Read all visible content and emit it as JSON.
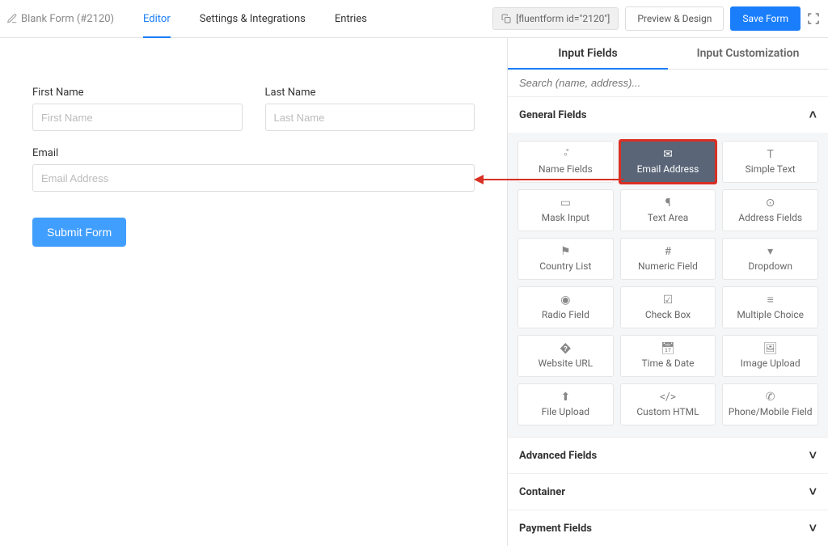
{
  "header": {
    "form_title": "Blank Form (#2120)",
    "tabs": {
      "editor": "Editor",
      "settings": "Settings & Integrations",
      "entries": "Entries"
    },
    "shortcode": "[fluentform id=\"2120\"]",
    "preview_btn": "Preview & Design",
    "save_btn": "Save Form"
  },
  "canvas": {
    "first_name": {
      "label": "First Name",
      "placeholder": "First Name"
    },
    "last_name": {
      "label": "Last Name",
      "placeholder": "Last Name"
    },
    "email": {
      "label": "Email",
      "placeholder": "Email Address"
    },
    "submit": "Submit Form"
  },
  "sidebar": {
    "tabs": {
      "input": "Input Fields",
      "custom": "Input Customization"
    },
    "search_placeholder": "Search (name, address)...",
    "sections": {
      "general": "General Fields",
      "advanced": "Advanced Fields",
      "container": "Container",
      "payment": "Payment Fields"
    },
    "fields": {
      "name": "Name Fields",
      "email": "Email Address",
      "simple_text": "Simple Text",
      "mask": "Mask Input",
      "textarea": "Text Area",
      "address": "Address Fields",
      "country": "Country List",
      "numeric": "Numeric Field",
      "dropdown": "Dropdown",
      "radio": "Radio Field",
      "checkbox": "Check Box",
      "multi": "Multiple Choice",
      "url": "Website URL",
      "date": "Time & Date",
      "image": "Image Upload",
      "file": "File Upload",
      "html": "Custom HTML",
      "phone": "Phone/Mobile Field"
    }
  }
}
